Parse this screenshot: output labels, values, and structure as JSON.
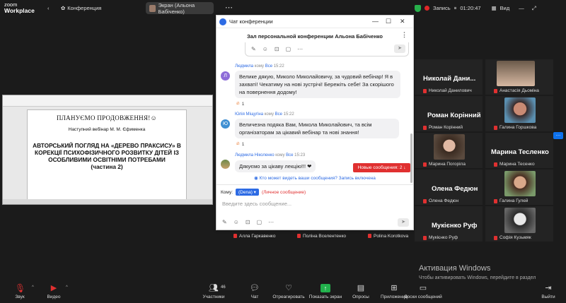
{
  "top": {
    "logo_line1": "zoom",
    "logo_line2": "Workplace",
    "conference_label": "Конференция",
    "screen_label": "Экран (Альона Бабіченко)",
    "record_label": "Запись",
    "timer": "01:20:47",
    "view_label": "Вид"
  },
  "shared_doc": {
    "line1": "ПЛАНУЄМО ПРОДОВЖЕННЯ!☺",
    "line2": "Наступний вебінар М. М. Єфименка",
    "line3": "АВТОРСЬКИЙ ПОГЛЯД НА «ДЕРЕВО ПРАКСИСУ» В КОРЕКЦІЇ ПСИХОФІЗИЧНОГО РОЗВИТКУ ДІТЕЙ ІЗ ОСОБЛИВИМИ ОСВІТНІМИ ПОТРЕБАМИ",
    "line4": "(частина 2)"
  },
  "chat": {
    "window_title": "Чат конференции",
    "header": "Зал персональной конференции Альона Бабіченко",
    "to_word": "кому",
    "messages": [
      {
        "sender": "Людмила",
        "to": "Все",
        "time": "15:22",
        "avatar": "Л",
        "avatar_color": "#8e6dd8",
        "text": "Велике дякую, Миколо Миколайовичу, за чудовий вебінар! Я в захваті! Чекатиму на нові зустрічі! Бережіть себе! За скорішого на повернення додому!",
        "reaction": "1"
      },
      {
        "sender": "Юлія Міщугіна",
        "to": "Все",
        "time": "15:22",
        "avatar": "Ю",
        "avatar_color": "#3f8fd2",
        "text": "Величезна подяка Вам, Микола Миколайович, та всім організаторам за цікавий вебінар та нові знання!",
        "reaction": "1"
      },
      {
        "sender": "Людмила Ніколенко",
        "to": "Все",
        "time": "15:23",
        "avatar": "",
        "text": "Дякуємо за цікаву лекцію!!! ❤"
      }
    ],
    "new_messages": "Новые сообщения: 2 ↓",
    "who_can_see": "Кто может видеть ваши сообщения? Запись включена",
    "to_label": "Кому:",
    "to_value": "(Dena) ▾",
    "private_label": "(Личное сообщение)",
    "compose_placeholder": "Введите здесь сообщение..."
  },
  "gallery": [
    {
      "name": "Николай Дани...",
      "caption": "Николай Данилович"
    },
    {
      "name": "",
      "caption": "Анастасія Дьоміна"
    },
    {
      "name": "Роман Корінний",
      "caption": "Роман Корінний"
    },
    {
      "name": "",
      "caption": "Галина Горшкова"
    },
    {
      "name": "",
      "caption": "Марина Погоріла"
    },
    {
      "name": "Марина Тесленко",
      "caption": "Марина Тесенко"
    },
    {
      "name": "Олена Федюн",
      "caption": "Олена Федюн"
    },
    {
      "name": "",
      "caption": "Галина Гулей"
    },
    {
      "name": "Мукієнко Руф",
      "caption": "Мукієнко Руф"
    },
    {
      "name": "",
      "caption": "Софія Кузьмяк"
    }
  ],
  "strip": [
    "Алла Гаркавенко",
    "Поліна Вселентенко",
    "Polina Korotkova"
  ],
  "watermark": {
    "title": "Активация Windows",
    "text": "Чтобы активировать Windows, перейдите в раздел \"Параметры\"."
  },
  "toolbar": {
    "mute": "Звук",
    "video": "Видео",
    "participants": "Участники",
    "participants_count": "46",
    "chat": "Чат",
    "react": "Отреагировать",
    "share": "Показать экран",
    "polls": "Опросы",
    "apps": "Приложения",
    "whiteboards": "Доски сообщений",
    "leave": "Выйти"
  }
}
